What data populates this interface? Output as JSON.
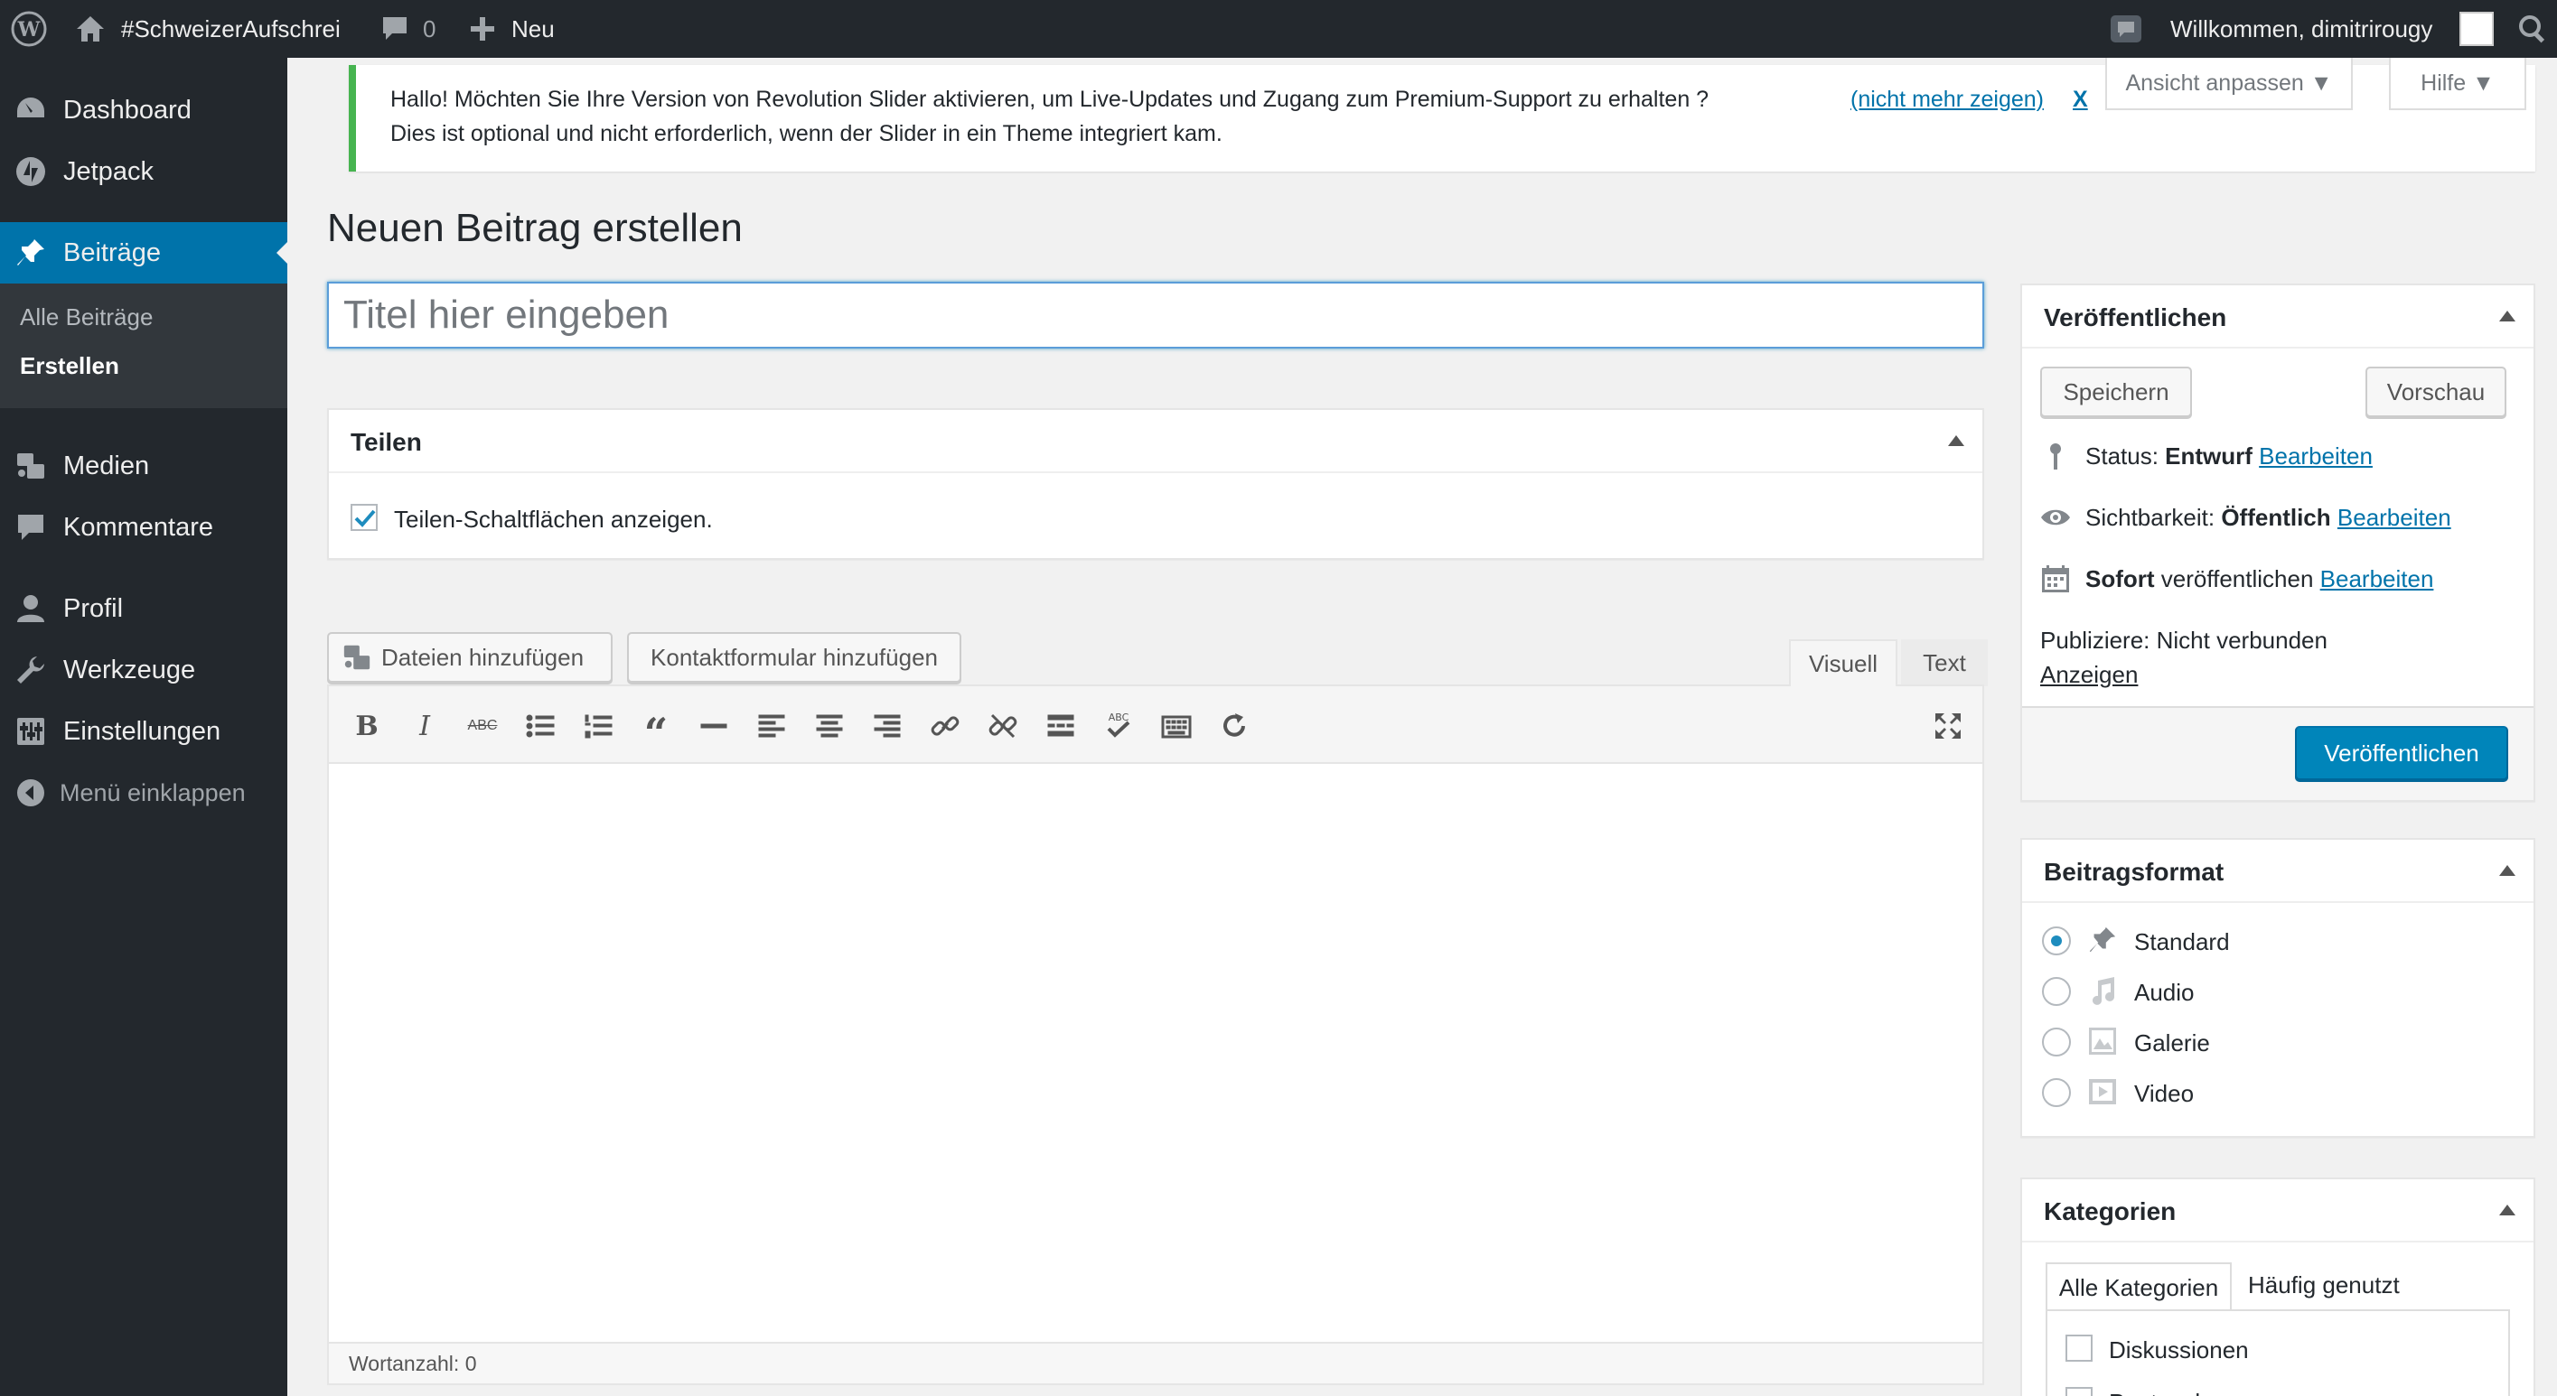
{
  "adminbar": {
    "site_name": "#SchweizerAufschrei",
    "comments_count": "0",
    "new_label": "Neu",
    "welcome": "Willkommen, dimitrirougy"
  },
  "sidebar": {
    "items": [
      {
        "label": "Dashboard",
        "icon": "dashboard-icon"
      },
      {
        "label": "Jetpack",
        "icon": "jetpack-icon"
      },
      {
        "label": "Beiträge",
        "icon": "pin-icon"
      },
      {
        "label": "Medien",
        "icon": "media-icon"
      },
      {
        "label": "Kommentare",
        "icon": "comment-icon"
      },
      {
        "label": "Profil",
        "icon": "user-icon"
      },
      {
        "label": "Werkzeuge",
        "icon": "wrench-icon"
      },
      {
        "label": "Einstellungen",
        "icon": "settings-icon"
      }
    ],
    "submenu": [
      "Alle Beiträge",
      "Erstellen"
    ],
    "collapse_label": "Menü einklappen"
  },
  "notice": {
    "line1": "Hallo! Möchten Sie Ihre Version von Revolution Slider aktivieren, um Live-Updates und Zugang zum Premium-Support zu erhalten ?",
    "line2": "Dies ist optional und nicht erforderlich, wenn der Slider in ein Theme integriert kam.",
    "dismiss_link": "(nicht mehr zeigen)",
    "dismiss_x": "X"
  },
  "screen_options": {
    "label": "Ansicht anpassen ▼"
  },
  "help": {
    "label": "Hilfe ▼"
  },
  "page": {
    "title": "Neuen Beitrag erstellen",
    "title_placeholder": "Titel hier eingeben"
  },
  "share_box": {
    "title": "Teilen",
    "checkbox_label": "Teilen-Schaltflächen anzeigen.",
    "checked": true
  },
  "media_buttons": {
    "add_files": "Dateien hinzufügen",
    "add_contact_form": "Kontaktformular hinzufügen"
  },
  "editor": {
    "tab_visual": "Visuell",
    "tab_text": "Text",
    "word_count": "Wortanzahl: 0"
  },
  "publish_box": {
    "title": "Veröffentlichen",
    "save_label": "Speichern",
    "preview_label": "Vorschau",
    "status_label": "Status:",
    "status_value": "Entwurf",
    "visibility_label": "Sichtbarkeit:",
    "visibility_value": "Öffentlich",
    "schedule_value": "Sofort",
    "schedule_label": "veröffentlichen",
    "edit_label": "Bearbeiten",
    "publicize_text": "Publiziere: Nicht verbunden",
    "publicize_link": "Anzeigen",
    "publish_button": "Veröffentlichen"
  },
  "format_box": {
    "title": "Beitragsformat",
    "options": [
      {
        "label": "Standard",
        "icon": "pin-icon",
        "selected": true
      },
      {
        "label": "Audio",
        "icon": "audio-icon",
        "selected": false
      },
      {
        "label": "Galerie",
        "icon": "gallery-icon",
        "selected": false
      },
      {
        "label": "Video",
        "icon": "video-icon",
        "selected": false
      }
    ]
  },
  "categories_box": {
    "title": "Kategorien",
    "tab_all": "Alle Kategorien",
    "tab_popular": "Häufig genutzt",
    "items": [
      "Diskussionen",
      "Poetry slam"
    ]
  },
  "colors": {
    "admin_dark": "#23282d",
    "accent": "#0073aa",
    "notice_green": "#46b450",
    "primary_button": "#0085ba"
  }
}
